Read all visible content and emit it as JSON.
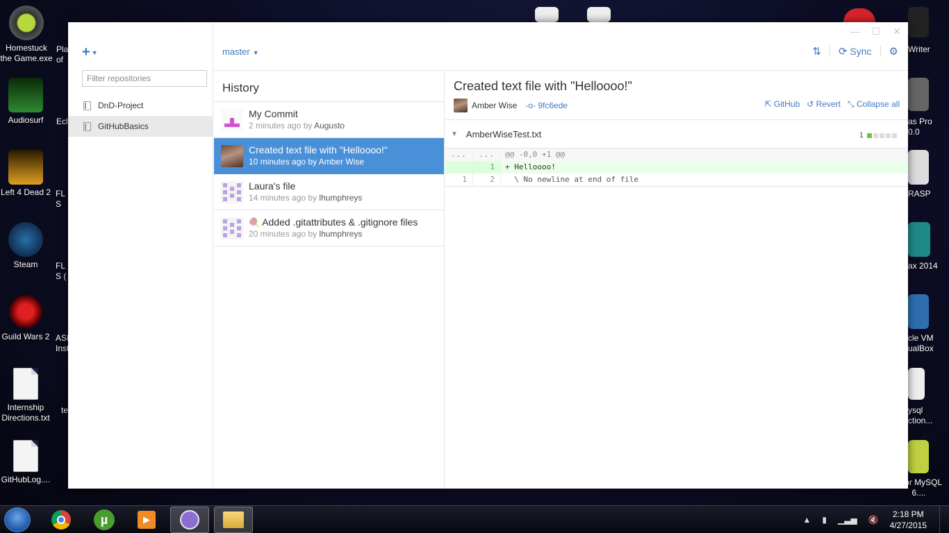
{
  "desktop": {
    "icons_left": [
      {
        "label": "Homestuck the Game.exe"
      },
      {
        "label": "Audiosurf"
      },
      {
        "label": "Left 4 Dead 2"
      },
      {
        "label": "Steam"
      },
      {
        "label": "Guild Wars 2"
      },
      {
        "label": "Internship Directions.txt"
      },
      {
        "label": "GitHubLog...."
      }
    ],
    "icons_second_col": [
      {
        "label": "Pla of"
      },
      {
        "label": "Ecli"
      },
      {
        "label": "FL S"
      },
      {
        "label": "FL S ("
      },
      {
        "label": "ASI Inst"
      },
      {
        "label": "te"
      }
    ],
    "icons_right": [
      {
        "label": "Writer"
      },
      {
        "label": "as Pro 0.0"
      },
      {
        "label": "RASP"
      },
      {
        "label": "ax 2014"
      },
      {
        "label": "cle VM ualBox"
      },
      {
        "label": "ysql ction..."
      },
      {
        "label": "d for MySQL 6...."
      }
    ]
  },
  "app": {
    "add_icon": "plus-icon",
    "filter_placeholder": "Filter repositories",
    "repositories": [
      {
        "name": "DnD-Project",
        "active": false
      },
      {
        "name": "GitHubBasics",
        "active": true
      }
    ],
    "branch": "master",
    "sync_label": "Sync",
    "history_title": "History",
    "commits": [
      {
        "title": "My Commit",
        "time": "2 minutes ago by",
        "author": "Augusto",
        "avatar": "pink",
        "selected": false
      },
      {
        "title": "Created text file with \"Helloooo!\"",
        "time": "10 minutes ago by",
        "author": "Amber Wise",
        "avatar": "photo",
        "selected": true
      },
      {
        "title": "Laura's file",
        "time": "14 minutes ago by",
        "author": "lhumphreys",
        "avatar": "purple",
        "selected": false
      },
      {
        "title": "Added .gitattributes & .gitignore files",
        "time": "20 minutes ago by",
        "author": "lhumphreys",
        "avatar": "purple",
        "selected": false
      }
    ],
    "detail": {
      "title": "Created text file with \"Helloooo!\"",
      "author": "Amber Wise",
      "sha": "9fc6ede",
      "github_label": "GitHub",
      "revert_label": "Revert",
      "collapse_label": "Collapse all"
    },
    "file": {
      "name": "AmberWiseTest.txt",
      "additions": "1"
    },
    "diff": {
      "hunk_old": "...",
      "hunk_new": "...",
      "hunk_header": "@@ -0,0 +1 @@",
      "added_new_ln": "1",
      "added_line": "+ Helloooo!",
      "ctx_old_ln": "1",
      "ctx_new_ln": "2",
      "ctx_line": "  \\ No newline at end of file"
    }
  },
  "taskbar": {
    "time": "2:18 PM",
    "date": "4/27/2015"
  },
  "colors": {
    "accent": "#4078c0",
    "selected": "#4a90d9",
    "added_bg": "#eaffea",
    "diffstat_add": "#6cc644"
  }
}
